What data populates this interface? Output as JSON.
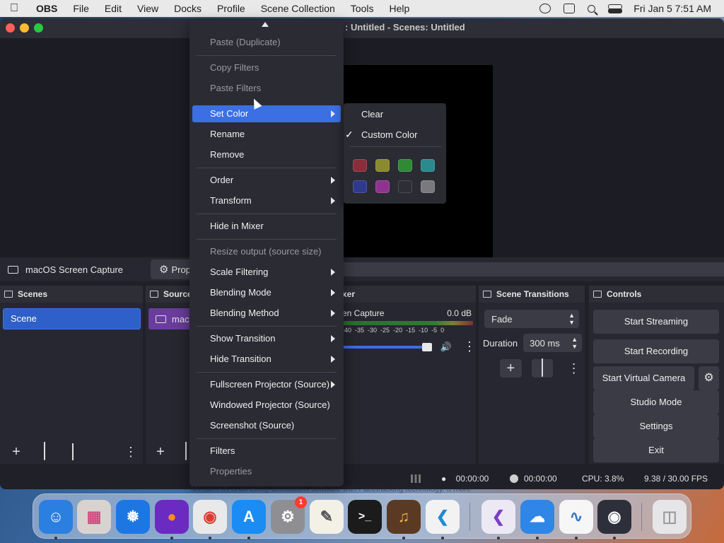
{
  "menubar": {
    "apple": "",
    "items": [
      "OBS",
      "File",
      "Edit",
      "View",
      "Docks",
      "Profile",
      "Scene Collection",
      "Tools",
      "Help"
    ],
    "clock": "Fri Jan 5  7:51 AM"
  },
  "window": {
    "title": ": Untitled - Scenes: Untitled"
  },
  "source_toolbar": {
    "source_name": "macOS Screen Capture",
    "properties_label": "Prop"
  },
  "scenes": {
    "title": "Scenes",
    "items": [
      "Scene"
    ]
  },
  "sources": {
    "title": "Source",
    "items": [
      "mac"
    ]
  },
  "mixer": {
    "title": "xer",
    "track_name": "en Capture",
    "track_level": "0.0 dB",
    "ticks": [
      "-40",
      "-35",
      "-30",
      "-25",
      "-20",
      "-15",
      "-10",
      "-5",
      "0"
    ]
  },
  "transitions": {
    "title": "Scene Transitions",
    "selected": "Fade",
    "duration_label": "Duration",
    "duration_value": "300 ms"
  },
  "controls": {
    "title": "Controls",
    "start_streaming": "Start Streaming",
    "start_recording": "Start Recording",
    "start_virtual_camera": "Start Virtual Camera",
    "studio_mode": "Studio Mode",
    "settings": "Settings",
    "exit": "Exit"
  },
  "status": {
    "stream_time": "00:00:00",
    "record_time": "00:00:00",
    "cpu": "CPU: 3.8%",
    "fps": "9.38 / 30.00 FPS"
  },
  "context_menu": {
    "paste_duplicate": "Paste (Duplicate)",
    "copy_filters": "Copy Filters",
    "paste_filters": "Paste Filters",
    "set_color": "Set Color",
    "rename": "Rename",
    "remove": "Remove",
    "order": "Order",
    "transform": "Transform",
    "hide_in_mixer": "Hide in Mixer",
    "resize_output": "Resize output (source size)",
    "scale_filtering": "Scale Filtering",
    "blending_mode": "Blending Mode",
    "blending_method": "Blending Method",
    "show_transition": "Show Transition",
    "hide_transition": "Hide Transition",
    "fullscreen_projector": "Fullscreen Projector (Source)",
    "windowed_projector": "Windowed Projector (Source)",
    "screenshot": "Screenshot (Source)",
    "filters": "Filters",
    "properties": "Properties"
  },
  "color_submenu": {
    "clear": "Clear",
    "custom_color": "Custom Color",
    "swatches": [
      "#8b2d3a",
      "#8a8a2e",
      "#2f8a34",
      "#2a8a8c",
      "#2f3a8e",
      "#8e3490",
      "#2e2f35",
      "#7a7a7e"
    ]
  },
  "dock": {
    "strip_text": "MTrial: FIN  is an Emoji animations software with Facetracking technology. It   more",
    "mail_badge": "1"
  }
}
